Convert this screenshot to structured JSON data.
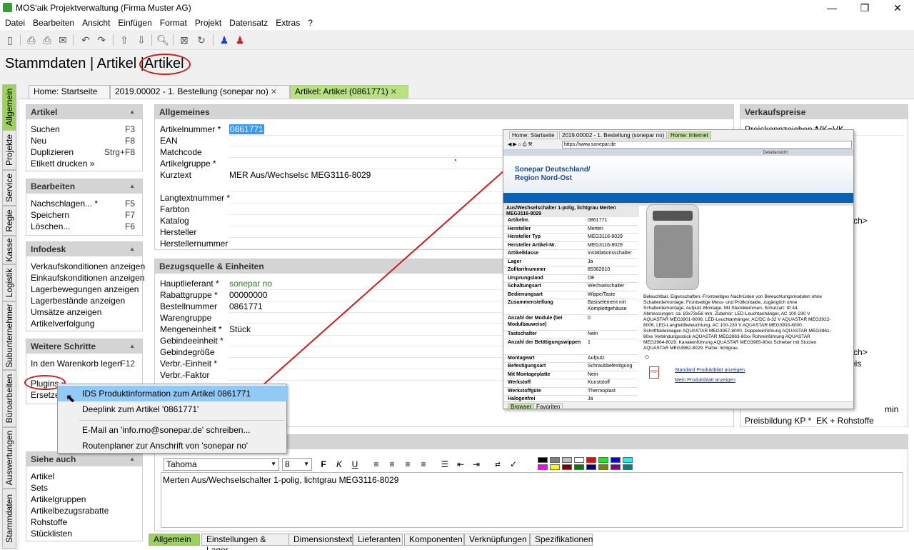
{
  "window": {
    "title": "MOS'aik Projektverwaltung (Firma Muster AG)",
    "minimize": "—",
    "restore": "❐",
    "close": "✕"
  },
  "menu": [
    "Datei",
    "Bearbeiten",
    "Ansicht",
    "Einfügen",
    "Format",
    "Projekt",
    "Datensatz",
    "Extras",
    "?"
  ],
  "breadcrumb": {
    "part1": "Stammdaten",
    "sep1": "|",
    "part2": "Artikel",
    "sep2": "|",
    "part3": "Artikel"
  },
  "vtabs": [
    "Allgemein",
    "Projekte",
    "Service",
    "Regie",
    "Kasse",
    "Logistik",
    "Subunternehmer",
    "Büroarbeiten",
    "Auswertungen",
    "Stammdaten"
  ],
  "doc_tabs": [
    {
      "label": "Home: Startseite",
      "close": ""
    },
    {
      "label": "2019.00002 - 1. Bestellung (sonepar no)",
      "close": "✕"
    },
    {
      "label": "Artikel: Artikel (0861771)",
      "close": "✕"
    }
  ],
  "left": {
    "artikel": {
      "title": "Artikel",
      "items": [
        {
          "label": "Suchen",
          "key": "F3"
        },
        {
          "label": "Neu",
          "key": "F8"
        },
        {
          "label": "Duplizieren",
          "key": "Strg+F8"
        },
        {
          "label": "Etikett drucken »",
          "key": ""
        }
      ]
    },
    "bearbeiten": {
      "title": "Bearbeiten",
      "items": [
        {
          "label": "Nachschlagen... *",
          "key": "F5"
        },
        {
          "label": "Speichern",
          "key": "F7"
        },
        {
          "label": "Löschen...",
          "key": "F6"
        }
      ]
    },
    "infodesk": {
      "title": "Infodesk",
      "items": [
        "Verkaufskonditionen anzeigen",
        "Einkaufskonditionen anzeigen",
        "Lagerbewegungen anzeigen",
        "Lagerbestände anzeigen",
        "Umsätze anzeigen",
        "Artikelverfolgung"
      ]
    },
    "weitere": {
      "title": "Weitere Schritte",
      "items": [
        {
          "label": "In den Warenkorb legen",
          "key": "F12"
        },
        {
          "label": "Plugins »",
          "key": ""
        },
        {
          "label": "Ersetze",
          "key": ""
        }
      ]
    },
    "siehe": {
      "title": "Siehe auch",
      "items": [
        "Artikel",
        "Sets",
        "Artikelgruppen",
        "Artikelbezugsrabatte",
        "Rohstoffe",
        "Stücklisten"
      ]
    }
  },
  "allgemeines": {
    "title": "Allgemeines",
    "fields": [
      {
        "label": "Artikelnummer *",
        "value": "0861771"
      },
      {
        "label": "EAN",
        "value": ""
      },
      {
        "label": "Matchcode",
        "value": ""
      },
      {
        "label": "Artikelgruppe *",
        "value": ""
      },
      {
        "label": "Kurztext",
        "value": "MER Aus/Wechselsc MEG3116-8029"
      },
      {
        "label": "",
        "value": ""
      },
      {
        "label": "Langtextnummer *",
        "value": ""
      },
      {
        "label": "Farbton",
        "value": ""
      },
      {
        "label": "Katalog",
        "value": ""
      },
      {
        "label": "Hersteller",
        "value": ""
      },
      {
        "label": "Herstellernummer",
        "value": ""
      }
    ]
  },
  "bezugsquelle": {
    "title": "Bezugsquelle & Einheiten",
    "fields": [
      {
        "label": "Hauptlieferant *",
        "value": "sonepar no"
      },
      {
        "label": "Rabattgruppe *",
        "value": "00000000"
      },
      {
        "label": "Bestellnummer",
        "value": "0861771"
      },
      {
        "label": "Warengruppe",
        "value": ""
      },
      {
        "label": "Mengeneinheit *",
        "value": "Stück"
      },
      {
        "label": "Gebindeeinheit *",
        "value": ""
      },
      {
        "label": "Gebindegröße",
        "value": ""
      },
      {
        "label": "Verbr.-Einheit *",
        "value": ""
      },
      {
        "label": "Verbr.-Faktor",
        "value": ""
      }
    ]
  },
  "verkaufspreise": {
    "title": "Verkaufspreise",
    "preiskennzeichen_label": "Preiskennzeichen *",
    "preiskennzeichen_value": "VK=VK",
    "partial1": "sch>",
    "partial2": "sch>",
    "partial3": "eis",
    "unit": "min",
    "preisbildung_label": "Preisbildung KP *",
    "preisbildung_value": "EK + Rohstoffe"
  },
  "context_menu": [
    "IDS Produktinformation zum Artikel 0861771",
    "Deeplink zum Artikel '0861771'",
    "E-Mail an 'info.rno@sonepar.de' schreiben...",
    "Routenplaner zur Anschrift von 'sonepar no'"
  ],
  "editor": {
    "font": "Tahoma",
    "size": "8",
    "text": "Merten Aus/Wechselschalter 1-polig, lichtgrau MEG3116-8029",
    "swatches": [
      "#000000",
      "#808080",
      "#c0c0c0",
      "#ffffff",
      "#ff0000",
      "#00ff00",
      "#0000ff",
      "#00ffff",
      "#ff00ff",
      "#ffff00",
      "#800000",
      "#008000",
      "#000080",
      "#808000",
      "#800080",
      "#008080"
    ]
  },
  "bottom_tabs": [
    "Allgemein",
    "Einstellungen & Lager",
    "Dimensionstext",
    "Lieferanten",
    "Komponenten",
    "Verknüpfungen",
    "Spezifikationen"
  ],
  "inset": {
    "tabs": [
      "Home: Startseite",
      "2019.00002 - 1. Bestellung (sonepar no)",
      "Home: Internet"
    ],
    "url": "https://www.sonepar.de",
    "detail": "Detailansicht",
    "company1": "Sonepar Deutschland/",
    "company2": "Region Nord-Ost",
    "prod_title": "Aus/Wechselschalter 1-polig, lichtgrau Merten MEG3116-8029",
    "rows": [
      {
        "k": "Artikelnr.",
        "v": "0861771"
      },
      {
        "k": "Hersteller",
        "v": "Merten"
      },
      {
        "k": "Hersteller Typ",
        "v": "MEG3116-8029"
      },
      {
        "k": "Hersteller Artikel-Nr.",
        "v": "MEG3116-8029"
      },
      {
        "k": "Artikelklasse",
        "v": "Installationsschalter"
      },
      {
        "k": "Lager",
        "v": "Ja"
      },
      {
        "k": "Zolltarifnummer",
        "v": "85362010"
      },
      {
        "k": "Ursprungsland",
        "v": "DE"
      },
      {
        "k": "Schaltungsart",
        "v": "Wechselschalter"
      },
      {
        "k": "Bedienungsart",
        "v": "Wippe/Taste"
      },
      {
        "k": "Zusammenstellung",
        "v": "Basiselement mit Komplettgehäuse"
      },
      {
        "k": "Anzahl der Module (bei Modulbauweise)",
        "v": "0"
      },
      {
        "k": "Tastschalter",
        "v": "Nein"
      },
      {
        "k": "Anzahl der Betätigungswippen",
        "v": "1"
      },
      {
        "k": "Montageart",
        "v": "Aufputz"
      },
      {
        "k": "Befestigungsart",
        "v": "Schraubbefestigung"
      },
      {
        "k": "Mit Montageplatte",
        "v": "Nein"
      },
      {
        "k": "Werkstoff",
        "v": "Kunststoff"
      },
      {
        "k": "Werkstoffgüte",
        "v": "Thermoplast"
      },
      {
        "k": "Halogenfrei",
        "v": "Ja"
      }
    ],
    "desc": [
      "Beleuchtbar. Eigenschaften:-Frontseitiges Nachrüsten von Beleuchtungsmodulen ohne",
      "Schalterdemontage. Frontseitige Mess- und Prüfkontakte, zugänglich ohne",
      "Schalterdemontage. Aufputz-Montage. Mit Steckklemmen. Schutzart: IP 44.",
      "Abmessungen: ca. 83x73x56 mm. Zubehör: LED-Leuchtanhänger, AC 100-230 V",
      "AQUASTAR MEG3901-8006. LED-Leuchtanhänger, AC/DC 8-32 V AQUASTAR MEG3922-",
      "8006. LED-Langfeldbeleuchtung, AC 100-230 V AQUASTAR MEG3903-8000.",
      "Schriftfeldeinlagen AQUASTAR MEG3957-8000. Doppeleinführung AQUASTAR MEG3961-",
      "80xx Verbindungsstück AQUASTAR MEG3963-80xx Rohreinführung AQUASTAR",
      "MEG3964-8029. Kanaleinführung AQUASTAR MEG3965-80xx Schieber mit Stutzen",
      "AQUASTAR MEG3962-8029. Farbe: lichtgrau."
    ],
    "link1": "Standard Produktblatt anzeigen",
    "link2": "Mein Produktblatt anzeigen",
    "pdf": "PDF",
    "btab1": "Browser",
    "btab2": "Favoriten"
  }
}
